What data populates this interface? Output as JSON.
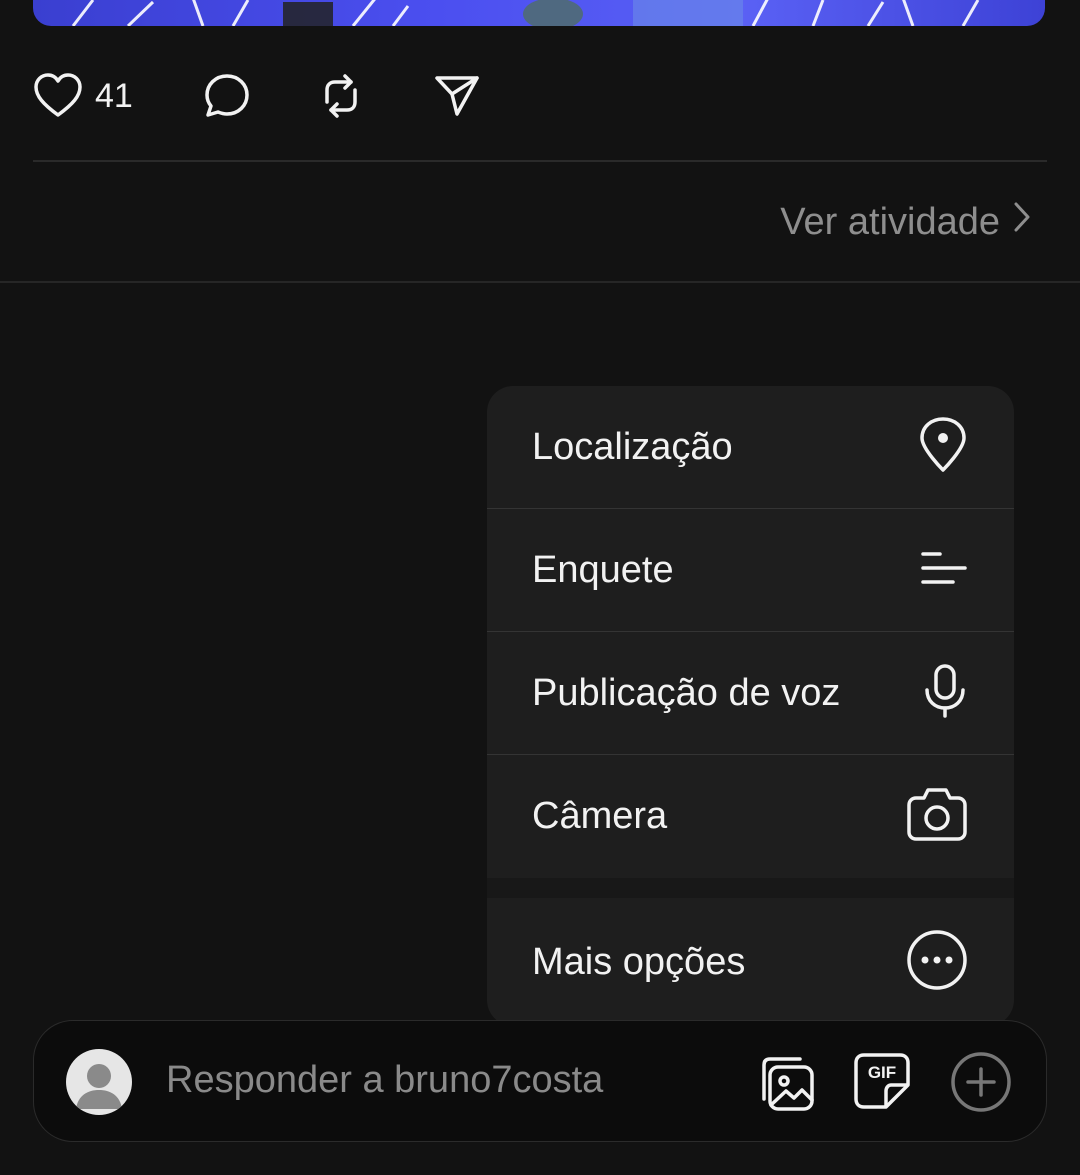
{
  "post": {
    "like_count": "41",
    "icons": [
      "heart-icon",
      "comment-icon",
      "repost-icon",
      "share-icon"
    ]
  },
  "activity": {
    "label": "Ver atividade",
    "icon": "chevron-right-icon"
  },
  "menu": {
    "items": [
      {
        "label": "Localização",
        "icon": "location-pin-icon"
      },
      {
        "label": "Enquete",
        "icon": "poll-icon"
      },
      {
        "label": "Publicação de voz",
        "icon": "microphone-icon"
      },
      {
        "label": "Câmera",
        "icon": "camera-icon"
      },
      {
        "label": "Mais opções",
        "icon": "more-options-icon"
      }
    ]
  },
  "composer": {
    "placeholder": "Responder a bruno7costa",
    "gif_label": "GIF",
    "icons": [
      "avatar",
      "gallery-icon",
      "gif-sticker-icon",
      "add-icon"
    ]
  },
  "colors": {
    "background": "#121212",
    "menu_background": "#1e1e1e",
    "muted_text": "#8e8e8e",
    "primary_text": "#f2f2f2"
  }
}
